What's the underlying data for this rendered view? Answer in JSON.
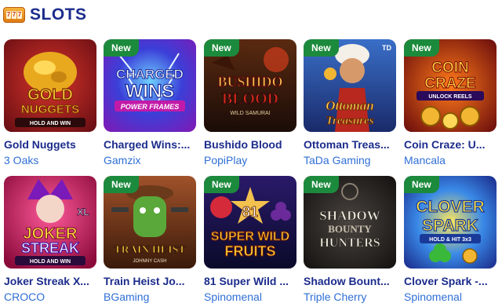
{
  "section": {
    "title": "SLOTS",
    "icon": "slot-machine-icon"
  },
  "badge_label": "New",
  "games": [
    {
      "name": "Gold Nuggets",
      "provider": "3 Oaks",
      "new": false,
      "art_text": [
        "GOLD",
        "NUGGETS",
        "HOLD AND WIN"
      ]
    },
    {
      "name": "Charged Wins:...",
      "provider": "Gamzix",
      "new": true,
      "art_text": [
        "CHARGED",
        "WINS",
        "POWER FRAMES"
      ]
    },
    {
      "name": "Bushido Blood",
      "provider": "PopiPlay",
      "new": true,
      "art_text": [
        "BUSHIDO",
        "BLOOD",
        "WILD SAMURAI"
      ]
    },
    {
      "name": "Ottoman Treas...",
      "provider": "TaDa Gaming",
      "new": true,
      "art_text": [
        "Ottoman",
        "Treasures",
        "TD"
      ]
    },
    {
      "name": "Coin Craze: U...",
      "provider": "Mancala",
      "new": true,
      "art_text": [
        "COIN",
        "CRAZE",
        "UNLOCK REELS"
      ]
    },
    {
      "name": "Joker Streak X...",
      "provider": "CROCO",
      "new": false,
      "art_text": [
        "JOKER",
        "STREAK",
        "HOLD AND WIN",
        "XL"
      ]
    },
    {
      "name": "Train Heist Jo...",
      "provider": "BGaming",
      "new": true,
      "art_text": [
        "TRAIN HEIST",
        "JOHNNY CASH"
      ]
    },
    {
      "name": "81 Super Wild ...",
      "provider": "Spinomenal",
      "new": true,
      "art_text": [
        "81",
        "SUPER WILD",
        "FRUITS"
      ]
    },
    {
      "name": "Shadow Bount...",
      "provider": "Triple Cherry",
      "new": true,
      "art_text": [
        "SHADOW",
        "BOUNTY",
        "HUNTERS"
      ]
    },
    {
      "name": "Clover Spark -...",
      "provider": "Spinomenal",
      "new": true,
      "art_text": [
        "CLOVER",
        "SPARK",
        "HOLD & HIT 3x3"
      ]
    }
  ]
}
